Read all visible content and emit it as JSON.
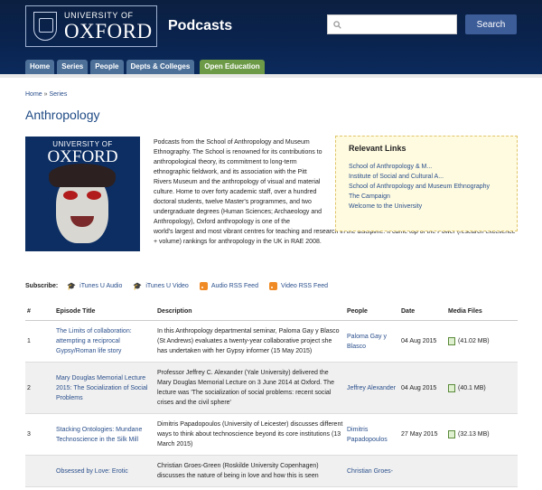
{
  "header": {
    "logo_small": "UNIVERSITY OF",
    "logo_big": "OXFORD",
    "site_title": "Podcasts",
    "search_placeholder": "",
    "search_button": "Search"
  },
  "tabs": [
    "Home",
    "Series",
    "People",
    "Depts & Colleges",
    "Open Education"
  ],
  "breadcrumb": {
    "home": "Home",
    "sep": " » ",
    "current": "Series"
  },
  "page_title": "Anthropology",
  "thumb": {
    "small": "UNIVERSITY OF",
    "big": "OXFORD"
  },
  "description_part1": "Podcasts from the School of Anthropology and Museum Ethnography. The School is renowned for its contributions to anthropological theory, its commitment to long-term ethnographic fieldwork, and its association with the Pitt Rivers Museum and the anthropology of visual and material culture. Home to over forty academic staff, over a hundred doctoral students, twelve Master's programmes, and two undergraduate degrees (Human Sciences; Archaeology and Anthropology), Oxford anthropology is one of the",
  "description_part2": "world's largest and most vibrant centres for teaching and research in the discipline. It came top of the Power (research excellence + volume) rankings for anthropology in the UK in RAE 2008.",
  "relevant_links": {
    "title": "Relevant Links",
    "items": [
      "School of Anthropology & M...",
      "Institute of Social and Cultural A...",
      "School of Anthropology and Museum Ethnography",
      "The Campaign",
      "Welcome to the University"
    ]
  },
  "subscribe": {
    "label": "Subscribe:",
    "itunes_audio": "iTunes U Audio",
    "itunes_video": "iTunes U Video",
    "audio_rss": "Audio RSS Feed",
    "video_rss": "Video RSS Feed"
  },
  "table": {
    "headers": [
      "#",
      "Episode Title",
      "Description",
      "People",
      "Date",
      "Media Files"
    ],
    "rows": [
      {
        "num": "1",
        "title": "The Limits of collaboration: attempting a reciprocal Gypsy/Roman life story",
        "desc": "In this Anthropology departmental seminar, Paloma Gay y Blasco (St Andrews) evaluates a twenty-year collaborative project she has undertaken with her Gypsy informer (15 May 2015)",
        "people": "Paloma Gay y Blasco",
        "date": "04 Aug 2015",
        "media": "(41.02 MB)"
      },
      {
        "num": "2",
        "title": "Mary Douglas Memorial Lecture 2015: The Socialization of Social Problems",
        "desc": "Professor Jeffrey C. Alexander (Yale University) delivered the Mary Douglas Memorial Lecture on 3 June 2014 at Oxford. The lecture was 'The socialization of social problems: recent social crises and the civil sphere'",
        "people": "Jeffrey Alexander",
        "date": "04 Aug 2015",
        "media": "(40.1 MB)"
      },
      {
        "num": "3",
        "title": "Stacking Ontologies: Mundane Technoscience in the Silk Mill",
        "desc": "Dimitris Papadopoulos (University of Leicester) discusses different ways to think about technoscience beyond its core institutions (13 March 2015)",
        "people": "Dimitris Papadopoulos",
        "date": "27 May 2015",
        "media": "(32.13 MB)"
      },
      {
        "num": "",
        "title": "Obsessed by Love: Erotic",
        "desc": "Christian Groes-Green (Roskilde University Copenhagen) discusses the nature of being in love and how this is seen",
        "people": "Christian Groes-",
        "date": "",
        "media": ""
      }
    ]
  }
}
